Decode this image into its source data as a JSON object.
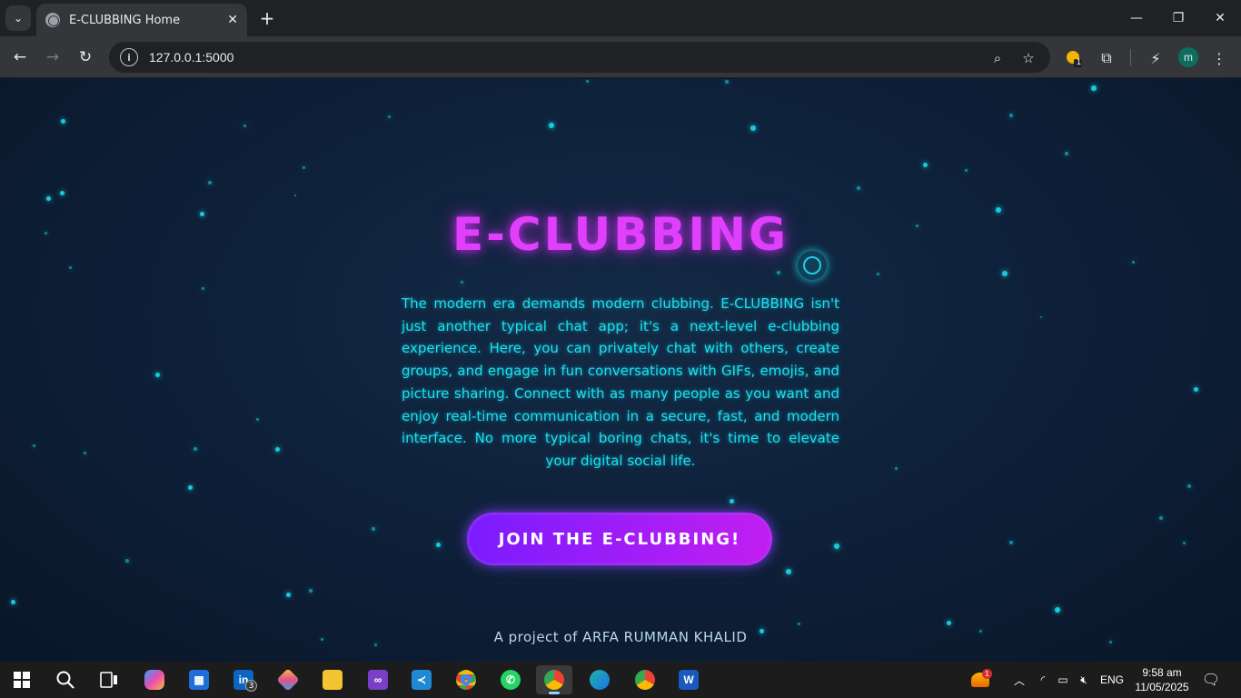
{
  "browser": {
    "tab_title": "E-CLUBBING Home",
    "tab_close": "✕",
    "new_tab": "+",
    "url": "127.0.0.1:5000",
    "window_controls": {
      "minimize": "—",
      "maximize": "❐",
      "close": "✕"
    },
    "profile_initial": "m",
    "extension_badge": "1"
  },
  "page": {
    "title": "E-CLUBBING",
    "description": "The modern era demands modern clubbing. E-CLUBBING isn't just another typical chat app; it's a next-level e-clubbing experience. Here, you can privately chat with others, create groups, and engage in fun conversations with GIFs, emojis, and picture sharing. Connect with as many people as you want and enjoy real-time communication in a secure, fast, and modern interface. No more typical boring chats, it's time to elevate your digital social life.",
    "cta_label": "JOIN THE E-CLUBBING!",
    "credit": "A project of ARFA RUMMAN KHALID",
    "accent_colors": {
      "title": "#e040fb",
      "text": "#19e1f0",
      "button_start": "#7a1cff",
      "button_end": "#c21ef0",
      "background": "#0d1f37"
    }
  },
  "taskbar": {
    "apps": [
      {
        "name": "start",
        "label": ""
      },
      {
        "name": "search",
        "label": ""
      },
      {
        "name": "task-view",
        "label": ""
      },
      {
        "name": "copilot",
        "label": ""
      },
      {
        "name": "microsoft-store",
        "label": ""
      },
      {
        "name": "linkedin",
        "label": "in",
        "badge": "3"
      },
      {
        "name": "git",
        "label": ""
      },
      {
        "name": "file-explorer",
        "label": ""
      },
      {
        "name": "visual-studio",
        "label": ""
      },
      {
        "name": "vscode",
        "label": ""
      },
      {
        "name": "chrome",
        "label": ""
      },
      {
        "name": "whatsapp",
        "label": ""
      },
      {
        "name": "chrome-profile",
        "label": ""
      },
      {
        "name": "edge",
        "label": ""
      },
      {
        "name": "chrome-alt",
        "label": ""
      },
      {
        "name": "word",
        "label": "W"
      }
    ],
    "tray": {
      "weather_badge": "1",
      "language": "ENG",
      "time": "9:58 am",
      "date": "11/05/2025"
    }
  }
}
